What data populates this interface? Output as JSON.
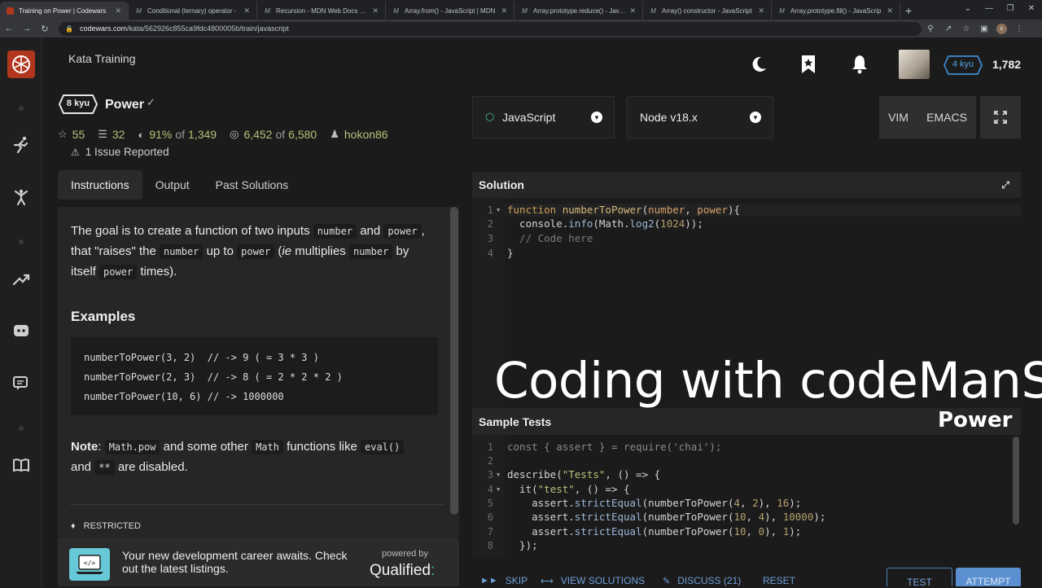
{
  "browser": {
    "tabs": [
      {
        "title": "Training on Power | Codewars",
        "fav": "",
        "active": true
      },
      {
        "title": "Conditional (ternary) operator -",
        "fav": "M",
        "active": false
      },
      {
        "title": "Recursion - MDN Web Docs Glo",
        "fav": "M",
        "active": false
      },
      {
        "title": "Array.from() - JavaScript | MDN",
        "fav": "M",
        "active": false
      },
      {
        "title": "Array.prototype.reduce() - JavaS",
        "fav": "M",
        "active": false
      },
      {
        "title": "Array() constructor - JavaScript",
        "fav": "M",
        "active": false
      },
      {
        "title": "Array.prototype.fill() - JavaScrip",
        "fav": "M",
        "active": false
      }
    ],
    "new_tab": "+",
    "url_domain": "codewars.com",
    "url_path": "/kata/562926c855ca9fdc4800005b/train/javascript",
    "profile_initial": "c"
  },
  "header": {
    "title": "Kata Training",
    "rank": "4 kyu",
    "honor": "1,782"
  },
  "kata": {
    "kyu": "8 kyu",
    "name": "Power",
    "stats": {
      "stars": "55",
      "collections": "32",
      "satisfaction": "91%",
      "of_word": "of",
      "votes": "1,349",
      "completed": "6,452",
      "warriors": "6,580",
      "author": "hokon86"
    },
    "issues": "1 Issue Reported"
  },
  "tabs": [
    "Instructions",
    "Output",
    "Past Solutions"
  ],
  "instructions": {
    "l1a": "The goal is to create a function of two inputs",
    "c_number": "number",
    "and": "and",
    "c_power": "power",
    "comma": ",",
    "l2a": "that \"raises\" the",
    "up_to": "up to",
    "ie_open": "(",
    "ie": "ie",
    "multiplies": "multiplies",
    "by": "by",
    "itself": "itself",
    "times": "times).",
    "examples_heading": "Examples",
    "examples": [
      "numberToPower(3, 2)  // -> 9 ( = 3 * 3 )",
      "numberToPower(2, 3)  // -> 8 ( = 2 * 2 * 2 )",
      "numberToPower(10, 6) // -> 1000000"
    ],
    "note_label": "Note",
    "note_colon": ":",
    "c_mathpow": "Math.pow",
    "note_mid": "and some other",
    "c_math": "Math",
    "note_fl": "functions like",
    "c_eval": "eval()",
    "note_and": "and",
    "c_pow": "**",
    "note_end": "are disabled.",
    "tag": "RESTRICTED"
  },
  "ad": {
    "text": "Your new development career awaits. Check out the latest listings.",
    "powered_by": "powered by",
    "brand": "Qualified",
    "brand_dot": ":"
  },
  "editor": {
    "language": "JavaScript",
    "runtime": "Node v18.x",
    "mode_vim": "VIM",
    "mode_emacs": "EMACS",
    "solution_title": "Solution",
    "tests_title": "Sample Tests"
  },
  "solution_lines": [
    {
      "n": "1",
      "fold": true
    },
    {
      "n": "2",
      "fold": false
    },
    {
      "n": "3",
      "fold": false
    },
    {
      "n": "4",
      "fold": false
    }
  ],
  "solution_code": {
    "l1_kw": "function",
    "l1_fn": "numberToPower",
    "l1_p1": "(",
    "l1_a1": "number",
    "l1_sep": ", ",
    "l1_a2": "power",
    "l1_end": "){",
    "l2_pre": "  console.",
    "l2_m1": "info",
    "l2_mid": "(Math.",
    "l2_m2": "log2",
    "l2_p": "(",
    "l2_num": "1024",
    "l2_end": "));",
    "l3": "  // Code here",
    "l4": "}"
  },
  "test_lines": [
    "1",
    "2",
    "3",
    "4",
    "5",
    "6",
    "7",
    "8"
  ],
  "test_code": {
    "l1_kw": "const",
    "l1_a": " { ",
    "l1_v": "assert",
    "l1_b": " } = require(",
    "l1_s": "'chai'",
    "l1_c": ");",
    "l3_a": "describe(",
    "l3_s": "\"Tests\"",
    "l3_b": ", () => {",
    "l4_a": "  it(",
    "l4_s": "\"test\"",
    "l4_b": ", () => {",
    "l5_a": "    assert.",
    "l5_m": "strictEqual",
    "l5_b": "(numberToPower(",
    "l5_n1": "4",
    "l5_c": ", ",
    "l5_n2": "2",
    "l5_d": "), ",
    "l5_n3": "16",
    "l5_e": ");",
    "l6_n1": "10",
    "l6_n2": "4",
    "l6_n3": "10000",
    "l7_n1": "10",
    "l7_n2": "0",
    "l7_n3": "1",
    "l8": "  });"
  },
  "actions": {
    "skip": "SKIP",
    "view_solutions": "VIEW SOLUTIONS",
    "discuss": "DISCUSS (21)",
    "reset": "RESET",
    "test": "TEST",
    "attempt": "ATTEMPT"
  },
  "overlay": {
    "title": "Coding with codeManS",
    "subtitle": "Power"
  },
  "colors": {
    "brand": "#b1361e",
    "accent": "#5b8fd0",
    "rank": "#3c7ebb"
  }
}
